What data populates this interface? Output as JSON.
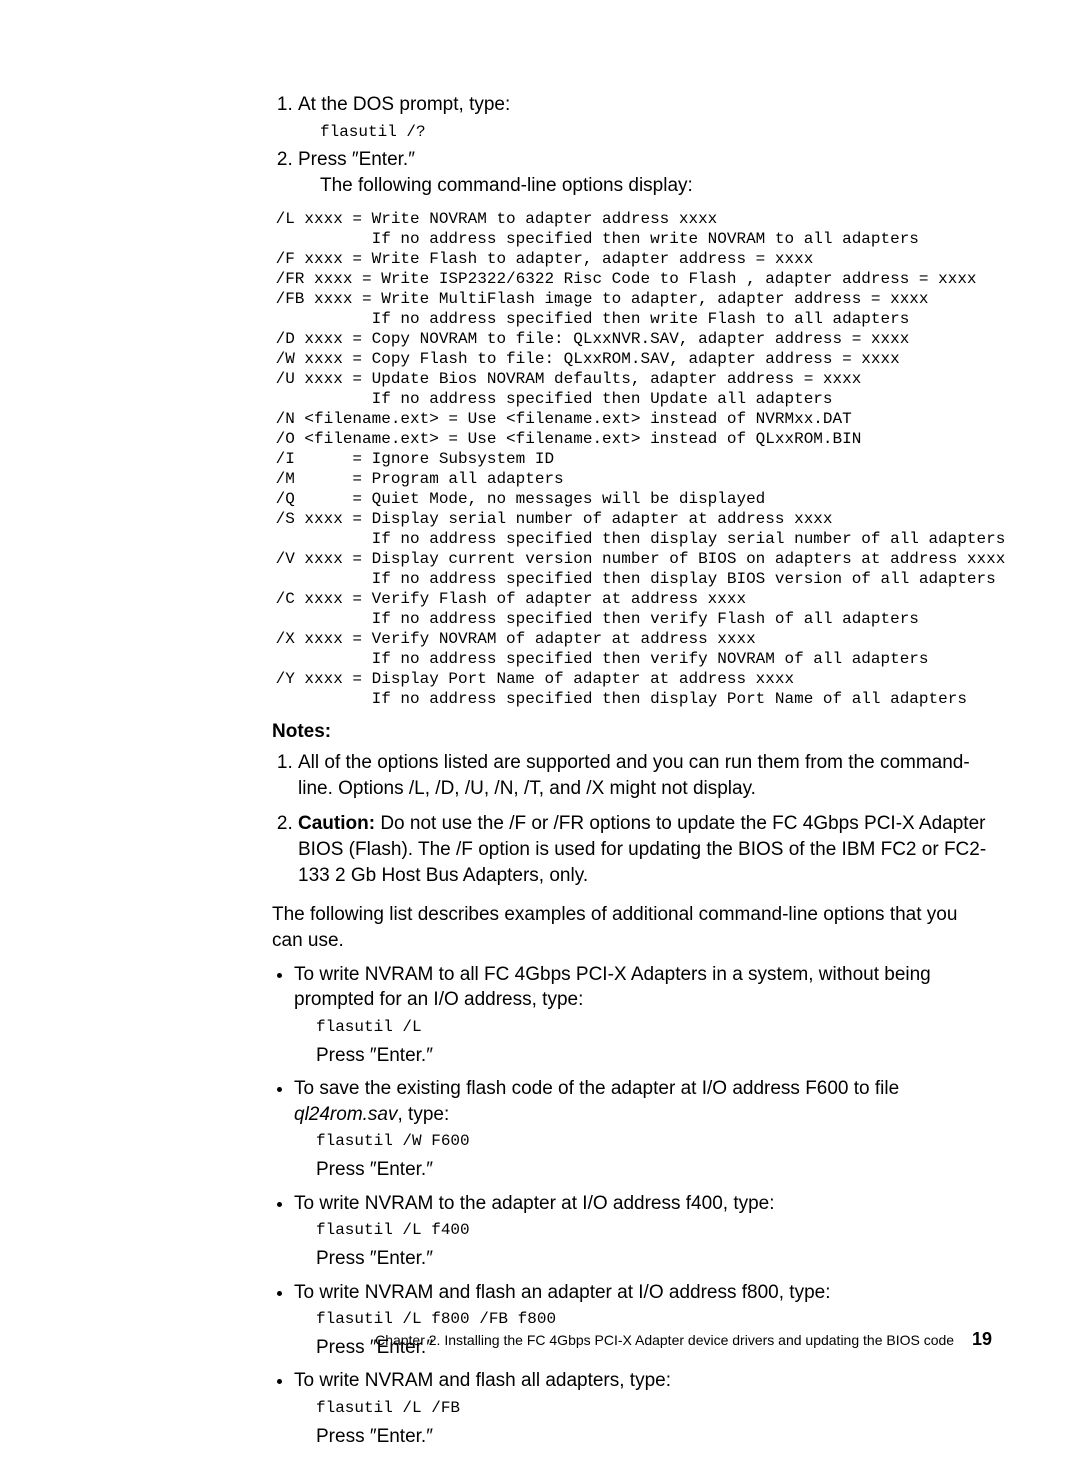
{
  "steps": {
    "s1": {
      "text": "At the DOS prompt, type:",
      "cmd": "flasutil /?"
    },
    "s2": {
      "text": "Press ″Enter.″",
      "sub": "The following command-line options display:"
    }
  },
  "cmdblock": " /L xxxx = Write NOVRAM to adapter address xxxx\n           If no address specified then write NOVRAM to all adapters\n /F xxxx = Write Flash to adapter, adapter address = xxxx\n /FR xxxx = Write ISP2322/6322 Risc Code to Flash , adapter address = xxxx\n /FB xxxx = Write MultiFlash image to adapter, adapter address = xxxx\n           If no address specified then write Flash to all adapters\n /D xxxx = Copy NOVRAM to file: QLxxNVR.SAV, adapter address = xxxx\n /W xxxx = Copy Flash to file: QLxxROM.SAV, adapter address = xxxx\n /U xxxx = Update Bios NOVRAM defaults, adapter address = xxxx\n           If no address specified then Update all adapters\n /N <filename.ext> = Use <filename.ext> instead of NVRMxx.DAT\n /O <filename.ext> = Use <filename.ext> instead of QLxxROM.BIN\n /I      = Ignore Subsystem ID\n /M      = Program all adapters\n /Q      = Quiet Mode, no messages will be displayed\n /S xxxx = Display serial number of adapter at address xxxx\n           If no address specified then display serial number of all adapters\n /V xxxx = Display current version number of BIOS on adapters at address xxxx\n           If no address specified then display BIOS version of all adapters\n /C xxxx = Verify Flash of adapter at address xxxx\n           If no address specified then verify Flash of all adapters\n /X xxxx = Verify NOVRAM of adapter at address xxxx\n           If no address specified then verify NOVRAM of all adapters\n /Y xxxx = Display Port Name of adapter at address xxxx\n           If no address specified then display Port Name of all adapters",
  "notes_head": "Notes:",
  "notes": {
    "n1": "All of the options listed are supported and you can run them from the command-line. Options /L, /D, /U, /N, /T, and /X might not display.",
    "n2_label": "Caution:",
    "n2_rest": " Do not use the /F or /FR options to update the FC 4Gbps PCI-X Adapter BIOS (Flash). The /F option is used for updating the BIOS of the IBM FC2 or FC2-133 2 Gb Host Bus Adapters, only."
  },
  "para": "The following list describes examples of additional command-line options that you can use.",
  "bullets": {
    "b1": {
      "text": "To write NVRAM to all FC 4Gbps PCI-X Adapters in a system, without being prompted for an I/O address, type:",
      "cmd": "flasutil /L",
      "after": "Press ″Enter.″"
    },
    "b2": {
      "text_a": "To save the existing flash code of the adapter at I/O address F600 to file ",
      "text_i": "ql24rom.sav",
      "text_b": ", type:",
      "cmd": "flasutil /W F600",
      "after": "Press ″Enter.″"
    },
    "b3": {
      "text": "To write NVRAM to the adapter at I/O address f400, type:",
      "cmd": "flasutil /L f400",
      "after": "Press ″Enter.″"
    },
    "b4": {
      "text": "To write NVRAM and flash an adapter at I/O address f800, type:",
      "cmd": "flasutil /L f800 /FB f800",
      "after": "Press ″Enter.″"
    },
    "b5": {
      "text": "To write NVRAM and flash all adapters, type:",
      "cmd": "flasutil /L /FB",
      "after": "Press ″Enter.″"
    }
  },
  "footer": {
    "chapter": "Chapter 2. Installing the FC 4Gbps PCI-X Adapter device drivers and updating the BIOS code",
    "page": "19"
  }
}
